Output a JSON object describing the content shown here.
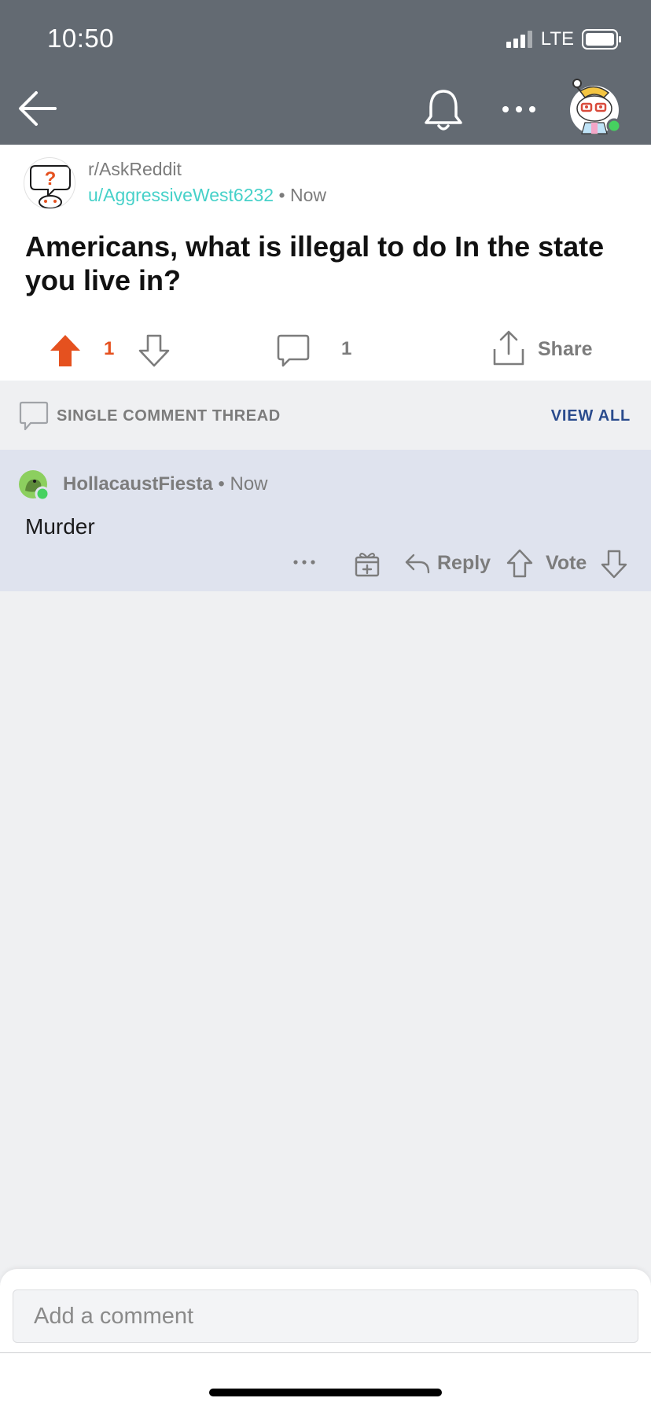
{
  "status_bar": {
    "time": "10:50",
    "network": "LTE"
  },
  "nav": {
    "icons": [
      "back-arrow-icon",
      "bell-icon",
      "more-icon",
      "avatar"
    ]
  },
  "post": {
    "subreddit": "r/AskReddit",
    "author": "u/AggressiveWest6232",
    "separator": "•",
    "time": "Now",
    "title": "Americans, what is illegal to do In the state you live in?",
    "score": "1",
    "comment_count": "1",
    "share_label": "Share",
    "colors": {
      "upvote": "#e5511f",
      "author": "#46d1c9"
    }
  },
  "thread": {
    "label": "SINGLE COMMENT THREAD",
    "view_all": "VIEW ALL"
  },
  "comment": {
    "author": "HollacaustFiesta",
    "separator": "•",
    "time": "Now",
    "body": "Murder",
    "reply_label": "Reply",
    "vote_label": "Vote"
  },
  "composer": {
    "placeholder": "Add a comment"
  }
}
